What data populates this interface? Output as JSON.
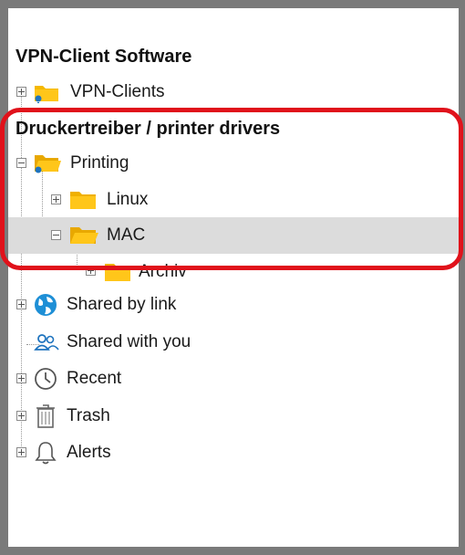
{
  "sections": {
    "vpn_heading": "VPN-Client Software",
    "drivers_heading": "Druckertreiber / printer drivers"
  },
  "tree": {
    "vpn_clients": "VPN-Clients",
    "printing": "Printing",
    "linux": "Linux",
    "mac": "MAC",
    "archiv": "Archiv",
    "shared_by_link": "Shared by link",
    "shared_with_you": "Shared with you",
    "recent": "Recent",
    "trash": "Trash",
    "alerts": "Alerts"
  },
  "icons": {
    "vpn_clients": "shared-folder-icon",
    "printing": "shared-folder-open-icon",
    "linux": "folder-icon",
    "mac": "folder-open-icon",
    "archiv": "folder-icon",
    "shared_by_link": "globe-icon",
    "shared_with_you": "users-icon",
    "recent": "clock-icon",
    "trash": "trash-icon",
    "alerts": "bell-icon"
  },
  "colors": {
    "folder": "#f5b800",
    "share_badge": "#1e73be",
    "highlight": "#e0121b",
    "selected_row": "#dcdcdc"
  }
}
